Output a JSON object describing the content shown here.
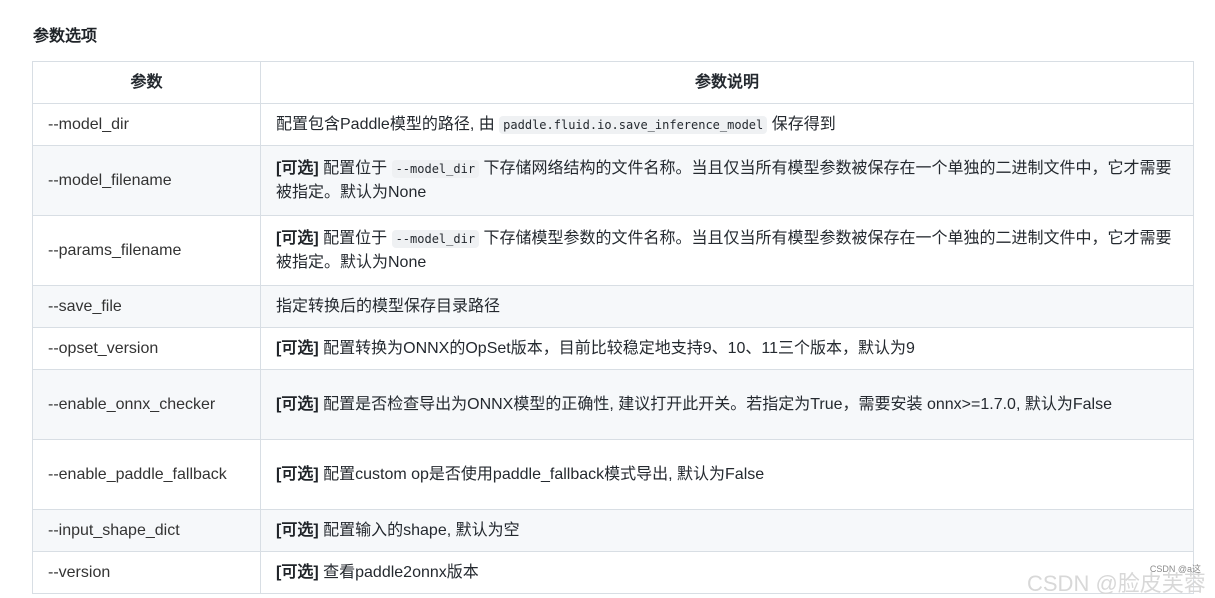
{
  "section_title": "参数选项",
  "table": {
    "headers": [
      "参数",
      "参数说明"
    ],
    "rows": [
      {
        "param": "--model_dir",
        "tag": "",
        "pre": "配置包含Paddle模型的路径, 由 ",
        "code": "paddle.fluid.io.save_inference_model",
        "post": " 保存得到"
      },
      {
        "param": "--model_filename",
        "tag": "[可选]",
        "pre": " 配置位于 ",
        "code": "--model_dir",
        "post": " 下存储网络结构的文件名称。当且仅当所有模型参数被保存在一个单独的二进制文件中，它才需要被指定。默认为None"
      },
      {
        "param": "--params_filename",
        "tag": "[可选]",
        "pre": " 配置位于 ",
        "code": "--model_dir",
        "post": " 下存储模型参数的文件名称。当且仅当所有模型参数被保存在一个单独的二进制文件中，它才需要被指定。默认为None"
      },
      {
        "param": "--save_file",
        "tag": "",
        "pre": "指定转换后的模型保存目录路径",
        "code": "",
        "post": ""
      },
      {
        "param": "--opset_version",
        "tag": "[可选]",
        "pre": " 配置转换为ONNX的OpSet版本，目前比较稳定地支持9、10、11三个版本，默认为9",
        "code": "",
        "post": ""
      },
      {
        "param": "--enable_onnx_checker",
        "tag": "[可选]",
        "pre": " 配置是否检查导出为ONNX模型的正确性, 建议打开此开关。若指定为True，需要安装 onnx>=1.7.0, 默认为False",
        "code": "",
        "post": ""
      },
      {
        "param": "--enable_paddle_fallback",
        "tag": "[可选]",
        "pre": " 配置custom op是否使用paddle_fallback模式导出, 默认为False",
        "code": "",
        "post": ""
      },
      {
        "param": "--input_shape_dict",
        "tag": "[可选]",
        "pre": " 配置输入的shape, 默认为空",
        "code": "",
        "post": ""
      },
      {
        "param": "--version",
        "tag": "[可选]",
        "pre": " 查看paddle2onnx版本",
        "code": "",
        "post": ""
      }
    ]
  },
  "watermark": {
    "small": "CSDN @a这",
    "large": "CSDN @脸皮芙蓉"
  }
}
